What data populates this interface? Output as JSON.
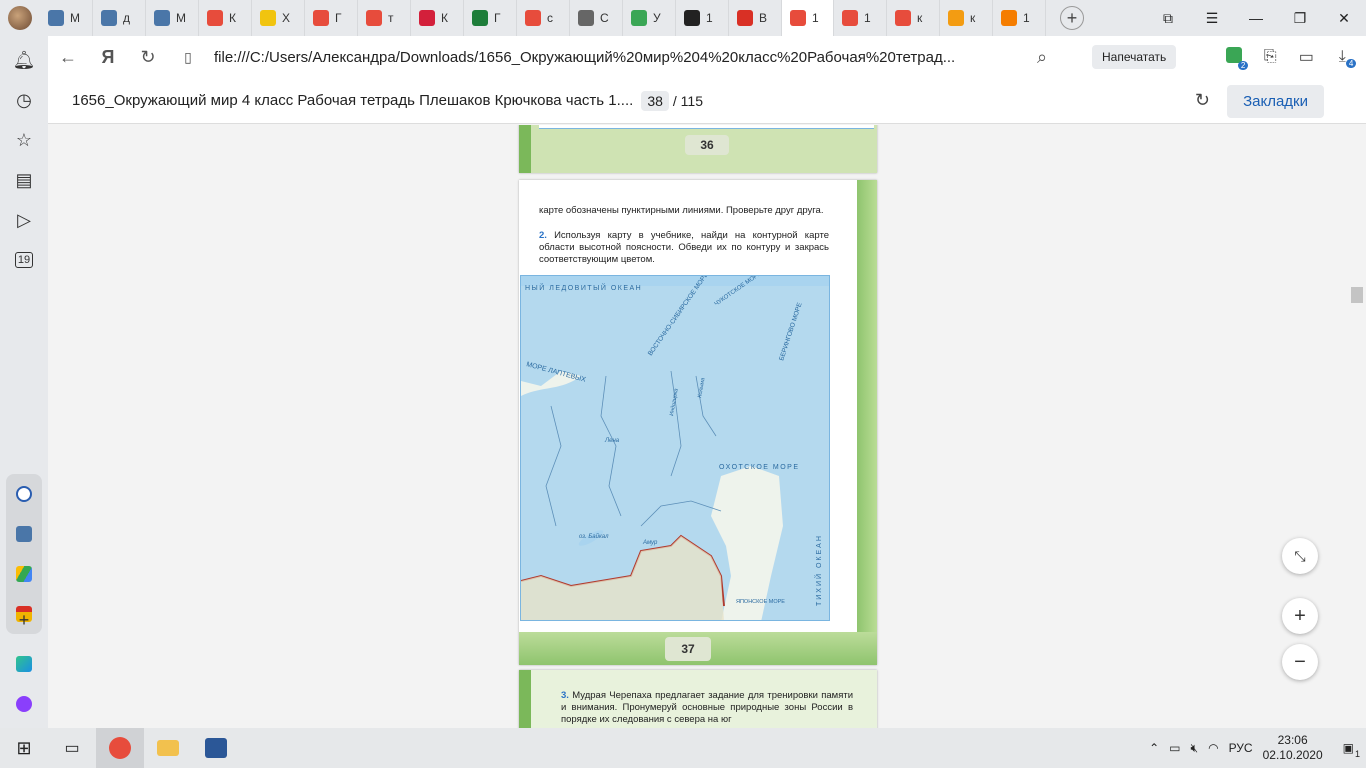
{
  "tabs": [
    {
      "icon": "message-icon",
      "label": "М",
      "color": "#4a76a8"
    },
    {
      "icon": "vk-icon",
      "label": "д",
      "color": "#4a76a8"
    },
    {
      "icon": "vk-icon",
      "label": "М",
      "color": "#4a76a8"
    },
    {
      "icon": "yandex-lyceum-icon",
      "label": "К",
      "color": "#e74c3c"
    },
    {
      "icon": "tab-icon",
      "label": "Х",
      "color": "#f1c40f"
    },
    {
      "icon": "yandex-lyceum-icon",
      "label": "Г",
      "color": "#e74c3c"
    },
    {
      "icon": "yandex-icon",
      "label": "т",
      "color": "#e74c3c"
    },
    {
      "icon": "video-icon",
      "label": "К",
      "color": "#d3203b"
    },
    {
      "icon": "check-icon",
      "label": "Г",
      "color": "#1e7d3a"
    },
    {
      "icon": "yandex-icon",
      "label": "с",
      "color": "#e74c3c"
    },
    {
      "icon": "document-icon",
      "label": "С",
      "color": "#666666"
    },
    {
      "icon": "uchi-icon",
      "label": "У",
      "color": "#3aa655"
    },
    {
      "icon": "circle-icon",
      "label": "1",
      "color": "#222222"
    },
    {
      "icon": "gmail-icon",
      "label": "В",
      "color": "#d93025"
    },
    {
      "icon": "pdf-icon",
      "label": "1",
      "color": "#e74c3c",
      "active": true
    },
    {
      "icon": "pdf-icon",
      "label": "1",
      "color": "#e74c3c"
    },
    {
      "icon": "yandex-icon",
      "label": "к",
      "color": "#e74c3c"
    },
    {
      "icon": "image-icon",
      "label": "к",
      "color": "#f39c12"
    },
    {
      "icon": "blogger-icon",
      "label": "1",
      "color": "#f57d00"
    }
  ],
  "address": {
    "url": "file:///C:/Users/Александра/Downloads/1656_Окружающий%20мир%204%20класс%20Рабочая%20тетрад...",
    "print_label": "Напечатать",
    "ext_badge_1": "2",
    "ext_badge_2": "4"
  },
  "pdf": {
    "title": "1656_Окружающий мир 4 класс Рабочая тетрадь Плешаков Крючкова часть 1....",
    "page_current": "38",
    "page_total": "/ 115",
    "bookmarks_label": "Закладки"
  },
  "document": {
    "page36_number": "36",
    "page37_text_1": "карте обозначены пунктирными линиями. Проверьте друг друга.",
    "page37_task_num": "2.",
    "page37_text_2": "Используя карту в учебнике, найди на контурной карте области высотной поясности. Обведи их по контуру и закрась соответствующим цветом.",
    "page37_number": "37",
    "page38_task_num": "3.",
    "page38_text": "Мудрая Черепаха предлагает задание для тренировки памяти и внимания. Пронумеруй основные природные зоны России в порядке их следования с севера на юг"
  },
  "map": {
    "labels": {
      "arctic_ocean": "НЫЙ ЛЕДОВИТЫЙ ОКЕАН",
      "east_siberian_sea": "ВОСТОЧНО-СИБИРСКОЕ МОРЕ",
      "chukchi_sea": "ЧУКОТСКОЕ МОРЕ",
      "bering_sea": "БЕРИНГОВО МОРЕ",
      "laptev_sea": "МОРЕ ЛАПТЕВЫХ",
      "okhotsk_sea": "ОХОТСКОЕ МОРЕ",
      "pacific_ocean": "ТИХИЙ ОКЕАН",
      "japan_sea": "ЯПОНСКОЕ МОРЕ",
      "baikal": "оз. Байкал",
      "amur": "Амур",
      "lena": "Лена",
      "indigirka": "Индигирка",
      "kolyma": "Колыма"
    }
  },
  "taskbar": {
    "lang": "РУС",
    "time": "23:06",
    "date": "02.10.2020",
    "notif_count": "1"
  }
}
